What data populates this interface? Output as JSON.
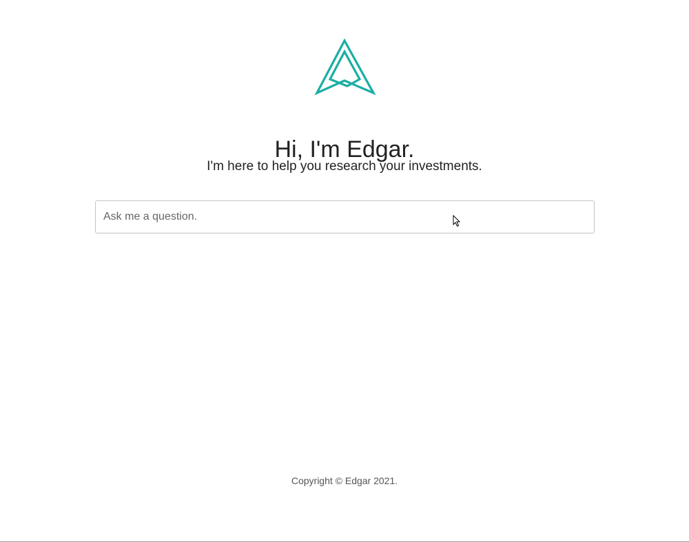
{
  "colors": {
    "accent": "#1aada3",
    "text": "#222222",
    "muted": "#555555",
    "border": "#c4c4c4"
  },
  "logo": {
    "icon": "edgar-triangle-logo-icon"
  },
  "hero": {
    "title": "Hi, I'm Edgar.",
    "subtitle": "I'm here to help you research your investments."
  },
  "search": {
    "placeholder": "Ask me a question.",
    "value": ""
  },
  "footer": {
    "copyright": "Copyright © Edgar 2021."
  }
}
